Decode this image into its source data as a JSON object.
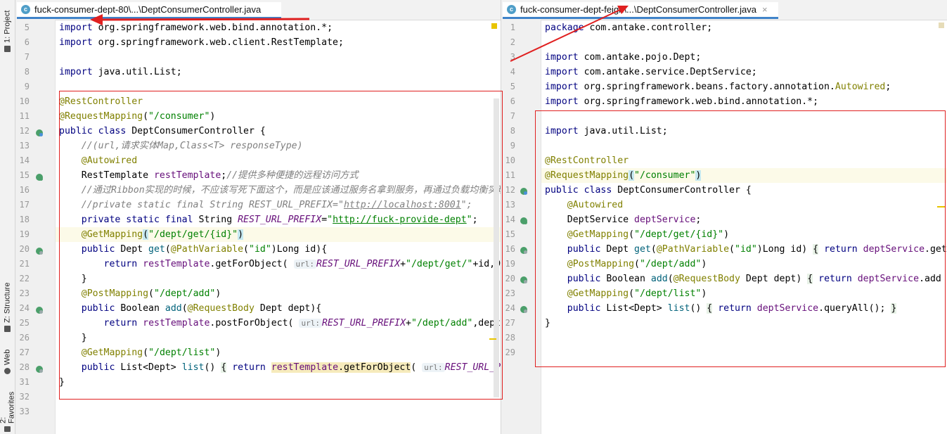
{
  "sidebar": {
    "project": "1: Project",
    "structure": "Z: Structure",
    "web": "Web",
    "favorites": "2: Favorites"
  },
  "left": {
    "tab_label": "fuck-consumer-dept-80\\...\\DeptConsumerController.java",
    "line_numbers": [
      "5",
      "6",
      "7",
      "8",
      "9",
      "10",
      "11",
      "12",
      "13",
      "14",
      "15",
      "16",
      "17",
      "18",
      "19",
      "20",
      "21",
      "22",
      "23",
      "24",
      "25",
      "26",
      "27",
      "28",
      "31",
      "32",
      "33"
    ],
    "hint_url": "url:"
  },
  "right": {
    "tab_label": "fuck-consumer-dept-feign\\...\\DeptConsumerController.java",
    "line_numbers": [
      "1",
      "2",
      "3",
      "4",
      "5",
      "6",
      "7",
      "8",
      "9",
      "10",
      "11",
      "12",
      "13",
      "14",
      "15",
      "16",
      "19",
      "20",
      "23",
      "24",
      "27",
      "28",
      "29"
    ],
    "close": "×"
  },
  "colors": {
    "annotation_box": "#e02020",
    "keyword": "#000080",
    "string": "#008000",
    "annotation": "#808000",
    "field": "#660e7a"
  }
}
